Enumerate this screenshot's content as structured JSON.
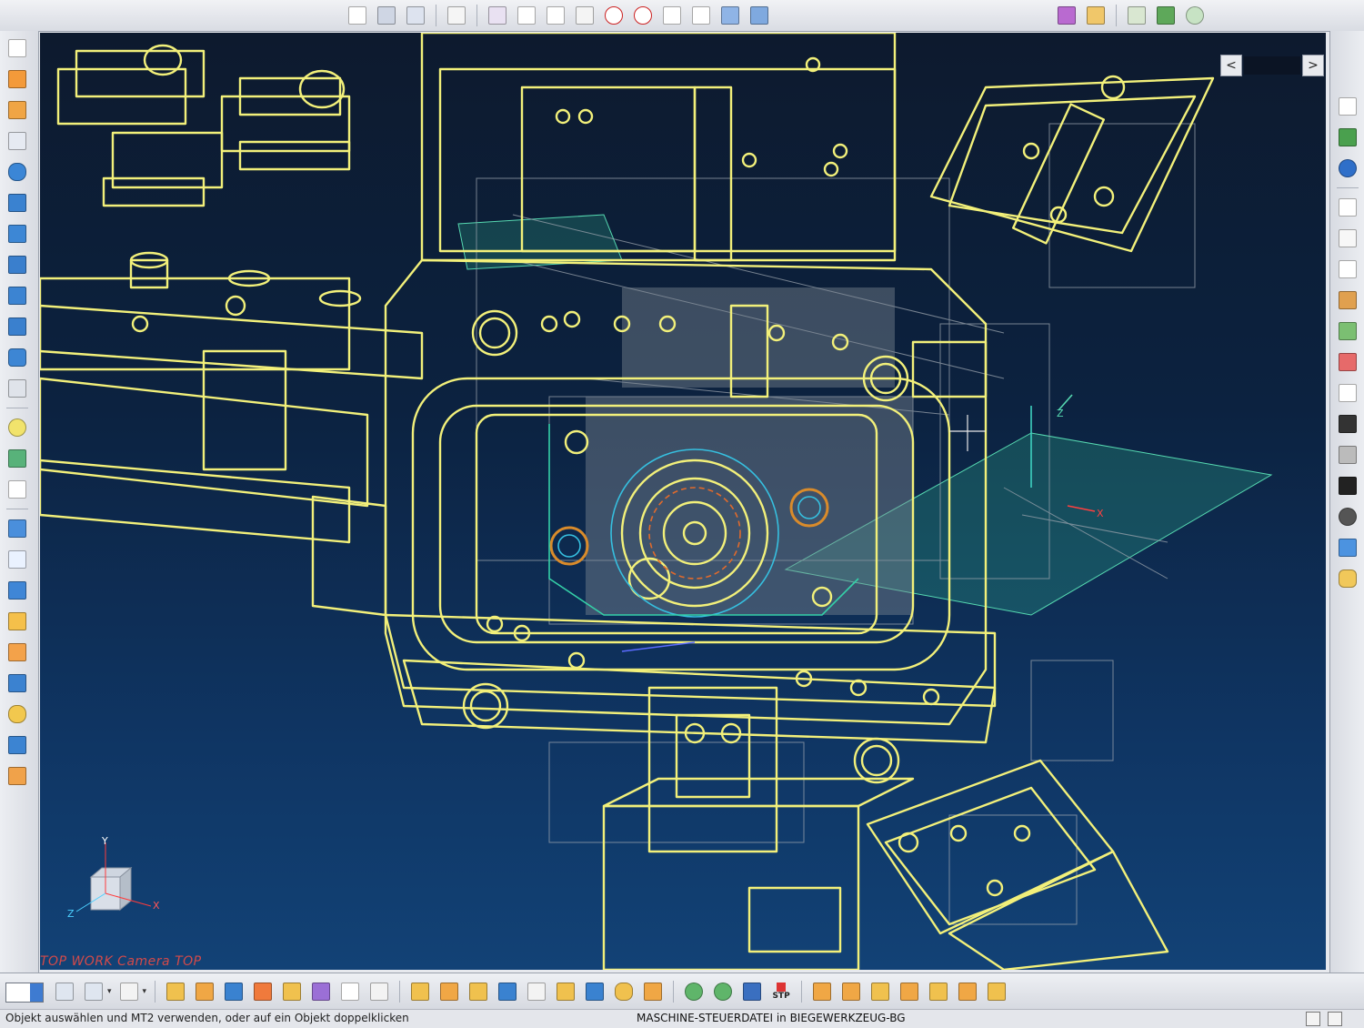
{
  "viewport": {
    "view_label": "TOP WORK Camera TOP",
    "axis_labels": {
      "x": "X",
      "y": "Y",
      "z": "Z"
    },
    "background_colors": {
      "top": "#0d1a2e",
      "bottom": "#124276"
    },
    "wire_color": "#f2f07a",
    "nav": {
      "prev": "<",
      "next": ">"
    }
  },
  "status": {
    "hint": "Objekt auswählen und MT2 verwenden, oder auf ein Objekt doppelklicken",
    "document": "MASCHINE-STEUERDATEI in BIEGEWERKZEUG-BG"
  },
  "bottom_toolbar": {
    "stp_label": "STP"
  },
  "icons": {
    "top": [
      "select-icon",
      "rotate-icon",
      "pan-icon",
      "grid-snap-icon",
      "point-icon",
      "line-icon",
      "arc-icon",
      "spline-icon",
      "center-icon",
      "circle-icon",
      "intersection-icon",
      "tangent-icon",
      "measure-icon",
      "view-solid-icon",
      "layer-icon",
      "palette-icon",
      "report-icon",
      "sheet-icon",
      "settings-icon"
    ],
    "left": [
      "sketch-icon",
      "extrude-icon",
      "revolve-icon",
      "hole-icon",
      "cylinder-icon",
      "box-icon",
      "cone-icon",
      "wedge-icon",
      "torus-icon",
      "shell-icon",
      "chamfer-icon",
      "fillet-icon",
      "sphere-icon",
      "surface-icon",
      "plane-icon",
      "solid-view-icon",
      "wireframe-icon",
      "section-icon",
      "mirror-icon",
      "pattern-icon",
      "combine-icon",
      "subtract-icon",
      "intersect-icon",
      "draft-icon"
    ],
    "right": [
      "expand-icon",
      "library-icon",
      "info-icon",
      "document-icon",
      "ruler-icon",
      "properties-icon",
      "color-icon",
      "users-icon",
      "image-icon",
      "norm-icon",
      "din-icon",
      "spring-icon",
      "part-icon",
      "sphere-shade-icon",
      "folder-icon",
      "database-icon"
    ]
  }
}
